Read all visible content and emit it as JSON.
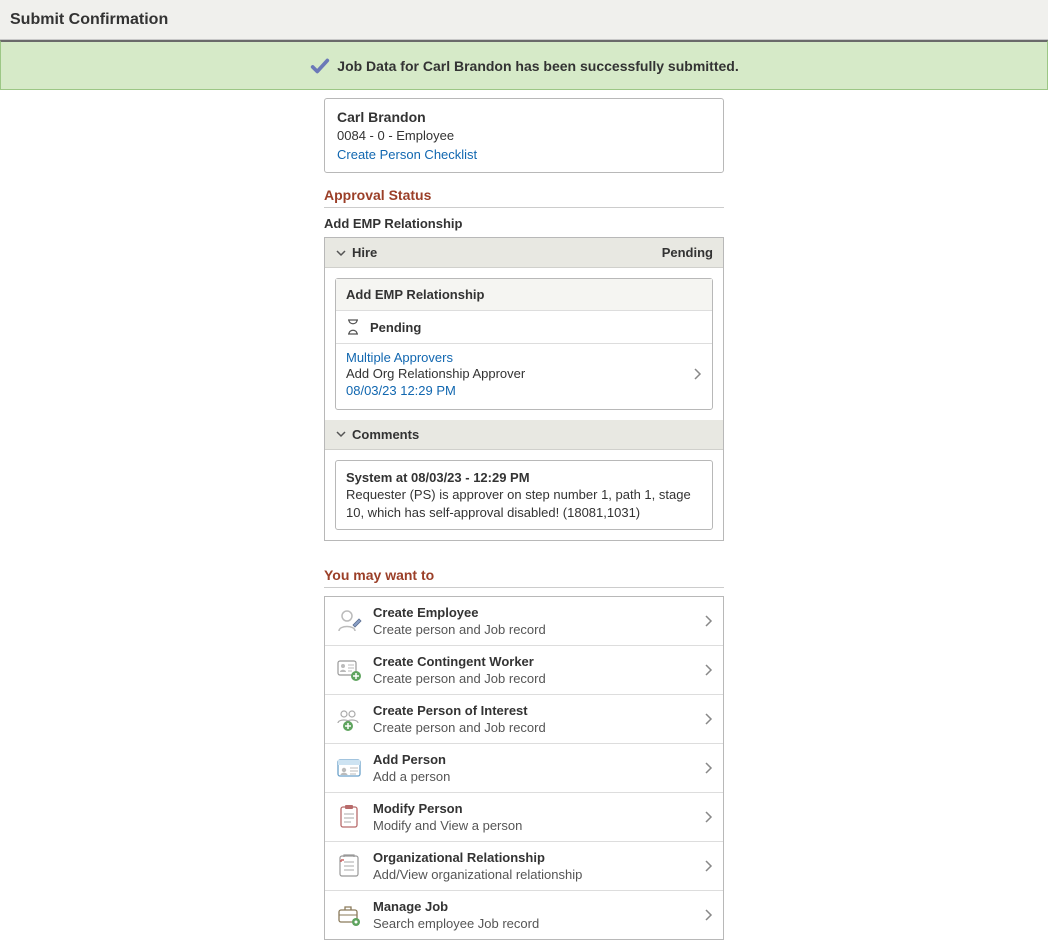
{
  "header": {
    "title": "Submit Confirmation"
  },
  "banner": {
    "text": "Job Data for Carl Brandon has been successfully submitted."
  },
  "person": {
    "name": "Carl Brandon",
    "subtitle": "0084 - 0 - Employee",
    "checklist_link": "Create Person Checklist"
  },
  "approval": {
    "section_title": "Approval Status",
    "relationship_label": "Add EMP Relationship",
    "hire": {
      "label": "Hire",
      "status": "Pending"
    },
    "card": {
      "title": "Add EMP Relationship",
      "status": "Pending",
      "approvers_link": "Multiple Approvers",
      "approver_role": "Add Org Relationship Approver",
      "timestamp": "08/03/23 12:29 PM"
    },
    "comments": {
      "label": "Comments",
      "header": "System at 08/03/23 - 12:29 PM",
      "body": "Requester (PS) is approver on step number 1, path 1, stage 10, which has self-approval disabled! (18081,1031)"
    }
  },
  "suggestions": {
    "section_title": "You may want to",
    "items": [
      {
        "title": "Create Employee",
        "subtitle": "Create person and Job record"
      },
      {
        "title": "Create Contingent Worker",
        "subtitle": "Create person and Job record"
      },
      {
        "title": "Create Person of Interest",
        "subtitle": "Create person and Job record"
      },
      {
        "title": "Add Person",
        "subtitle": "Add a person"
      },
      {
        "title": "Modify Person",
        "subtitle": "Modify and View a person"
      },
      {
        "title": "Organizational Relationship",
        "subtitle": "Add/View organizational relationship"
      },
      {
        "title": "Manage Job",
        "subtitle": "Search employee Job record"
      }
    ]
  }
}
